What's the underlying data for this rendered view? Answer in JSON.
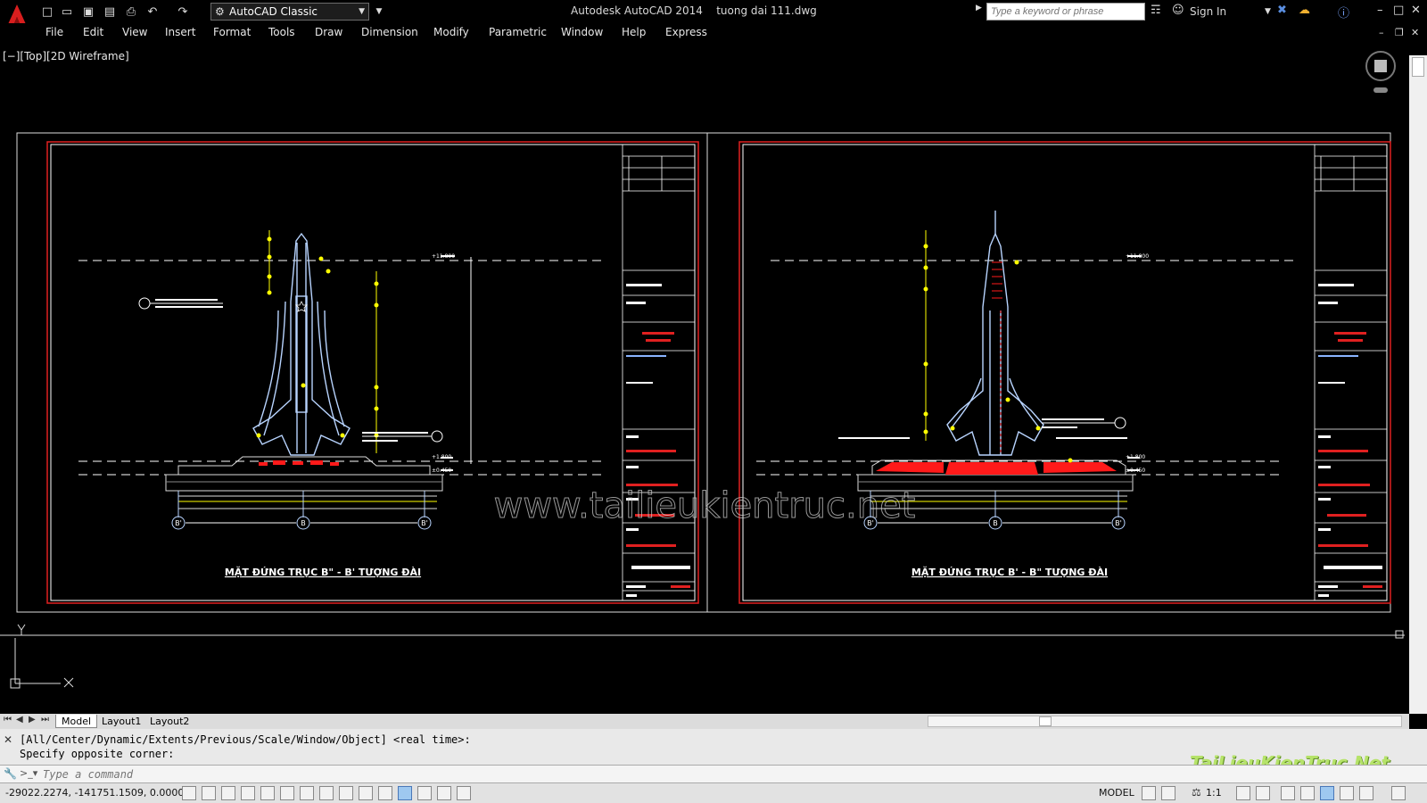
{
  "titlebar": {
    "workspace": "AutoCAD Classic",
    "app_name": "Autodesk AutoCAD 2014",
    "document": "tuong dai 111.dwg",
    "search_placeholder": "Type a keyword or phrase",
    "sign_in": "Sign In"
  },
  "menu": [
    "File",
    "Edit",
    "View",
    "Insert",
    "Format",
    "Tools",
    "Draw",
    "Dimension",
    "Modify",
    "Parametric",
    "Window",
    "Help",
    "Express"
  ],
  "viewport": {
    "label": "[−][Top][2D Wireframe]",
    "watermark": "www.tailieukientruc.net"
  },
  "drawings": [
    {
      "title": "MẶT ĐỨNG TRỤC B\" - B' TƯỢNG ĐÀI",
      "axis_labels": [
        "B'",
        "B",
        "B'"
      ],
      "level_top": "+11.800",
      "level_mid": "+1.800",
      "level_base": "±0.450"
    },
    {
      "title": "MẶT ĐỨNG TRỤC B' - B\" TƯỢNG ĐÀI",
      "axis_labels": [
        "B'",
        "B",
        "B'"
      ],
      "level_top": "+11.800",
      "level_mid": "+1.800",
      "level_base": "±0.450"
    }
  ],
  "tabs": [
    "Model",
    "Layout1",
    "Layout2"
  ],
  "active_tab": "Model",
  "command": {
    "history_line1": "[All/Center/Dynamic/Extents/Previous/Scale/Window/Object] <real time>:",
    "history_line2": "Specify opposite corner:",
    "placeholder": "Type a command",
    "brand_watermark": "TaiLieuKienTruc.Net"
  },
  "status": {
    "coords": "-29022.2274, -141751.1509, 0.0000",
    "model": "MODEL",
    "scale": "1:1"
  },
  "colors": {
    "frame_red": "#e02020",
    "cad_cyan": "#b8d4ff",
    "cad_yellow": "#ffff00",
    "hatch_red": "#ff1a1a"
  }
}
